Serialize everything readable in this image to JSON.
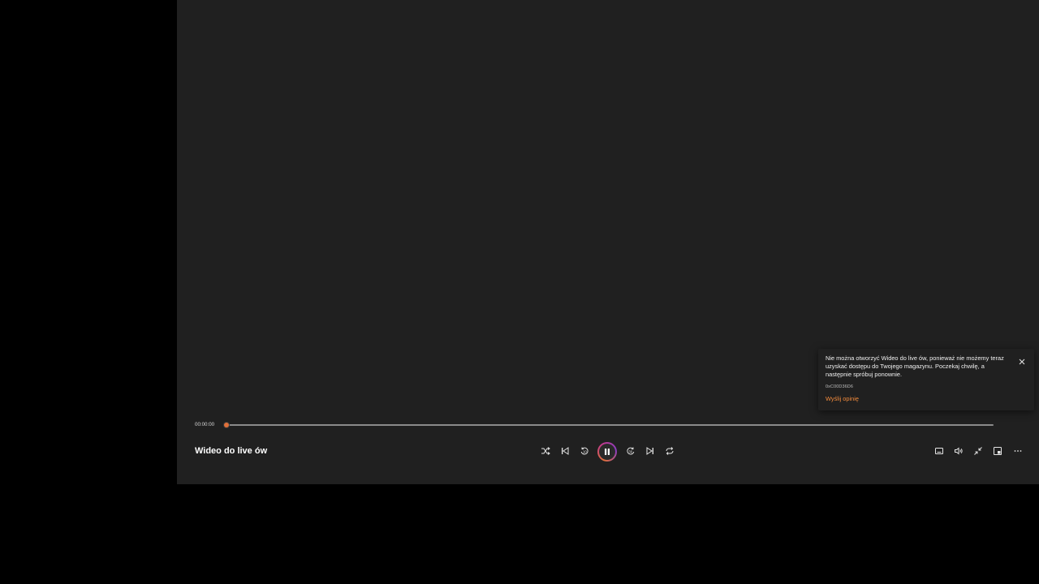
{
  "player": {
    "title": "Wideo do live ów",
    "current_time": "00:00:00",
    "progress_fraction": 0.0,
    "accent_color": "#e0703a"
  },
  "toast": {
    "message": "Nie można otworzyć Wideo do live ów, ponieważ nie możemy teraz uzyskać dostępu do Twojego magazynu. Poczekaj chwilę, a następnie spróbuj ponownie.",
    "error_code": "0xC00D36D6",
    "feedback_link": "Wyślij opinię"
  },
  "controls": {
    "left": [
      "shuffle-icon",
      "previous-icon",
      "rewind-10-icon"
    ],
    "center": "pause-icon",
    "right_group": [
      "forward-30-icon",
      "next-icon",
      "repeat-icon"
    ],
    "utility": [
      "subtitles-icon",
      "volume-icon",
      "mini-view-icon",
      "cast-icon",
      "more-icon"
    ]
  }
}
